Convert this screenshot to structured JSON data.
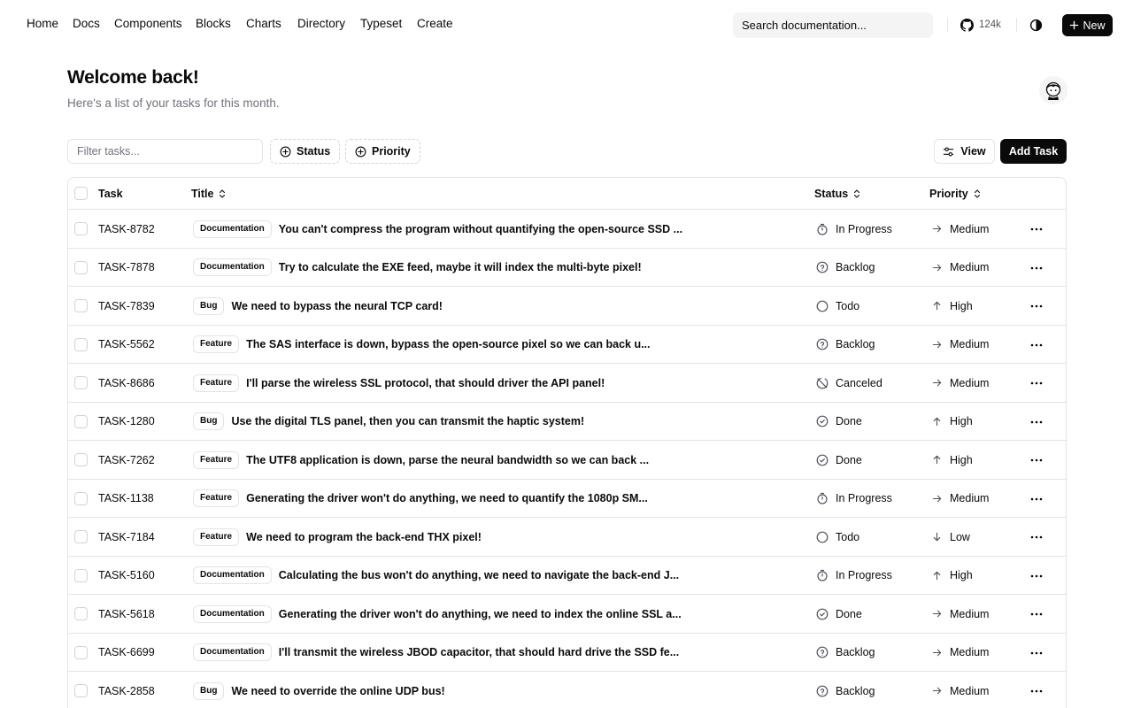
{
  "nav": {
    "links": [
      "Home",
      "Docs",
      "Components",
      "Blocks",
      "Charts",
      "Directory",
      "Typeset",
      "Create"
    ],
    "search_label": "Search documentation...",
    "github_stars": "124k",
    "new_label": "New"
  },
  "header": {
    "title": "Welcome back!",
    "subtitle": "Here's a list of your tasks for this month."
  },
  "toolbar": {
    "filter_placeholder": "Filter tasks...",
    "status_label": "Status",
    "priority_label": "Priority",
    "view_label": "View",
    "add_task_label": "Add Task"
  },
  "table": {
    "columns": {
      "task": "Task",
      "title": "Title",
      "status": "Status",
      "priority": "Priority"
    },
    "rows": [
      {
        "id": "TASK-8782",
        "label": "Documentation",
        "title": "You can't compress the program without quantifying the open-source SSD ...",
        "status": "In Progress",
        "status_icon": "timer-icon",
        "priority": "Medium",
        "priority_icon": "arrow-right-icon"
      },
      {
        "id": "TASK-7878",
        "label": "Documentation",
        "title": "Try to calculate the EXE feed, maybe it will index the multi-byte pixel!",
        "status": "Backlog",
        "status_icon": "help-circle-icon",
        "priority": "Medium",
        "priority_icon": "arrow-right-icon"
      },
      {
        "id": "TASK-7839",
        "label": "Bug",
        "title": "We need to bypass the neural TCP card!",
        "status": "Todo",
        "status_icon": "circle-icon",
        "priority": "High",
        "priority_icon": "arrow-up-icon"
      },
      {
        "id": "TASK-5562",
        "label": "Feature",
        "title": "The SAS interface is down, bypass the open-source pixel so we can back u...",
        "status": "Backlog",
        "status_icon": "help-circle-icon",
        "priority": "Medium",
        "priority_icon": "arrow-right-icon"
      },
      {
        "id": "TASK-8686",
        "label": "Feature",
        "title": "I'll parse the wireless SSL protocol, that should driver the API panel!",
        "status": "Canceled",
        "status_icon": "circle-off-icon",
        "priority": "Medium",
        "priority_icon": "arrow-right-icon"
      },
      {
        "id": "TASK-1280",
        "label": "Bug",
        "title": "Use the digital TLS panel, then you can transmit the haptic system!",
        "status": "Done",
        "status_icon": "check-circle-icon",
        "priority": "High",
        "priority_icon": "arrow-up-icon"
      },
      {
        "id": "TASK-7262",
        "label": "Feature",
        "title": "The UTF8 application is down, parse the neural bandwidth so we can back ...",
        "status": "Done",
        "status_icon": "check-circle-icon",
        "priority": "High",
        "priority_icon": "arrow-up-icon"
      },
      {
        "id": "TASK-1138",
        "label": "Feature",
        "title": "Generating the driver won't do anything, we need to quantify the 1080p SM...",
        "status": "In Progress",
        "status_icon": "timer-icon",
        "priority": "Medium",
        "priority_icon": "arrow-right-icon"
      },
      {
        "id": "TASK-7184",
        "label": "Feature",
        "title": "We need to program the back-end THX pixel!",
        "status": "Todo",
        "status_icon": "circle-icon",
        "priority": "Low",
        "priority_icon": "arrow-down-icon"
      },
      {
        "id": "TASK-5160",
        "label": "Documentation",
        "title": "Calculating the bus won't do anything, we need to navigate the back-end J...",
        "status": "In Progress",
        "status_icon": "timer-icon",
        "priority": "High",
        "priority_icon": "arrow-up-icon"
      },
      {
        "id": "TASK-5618",
        "label": "Documentation",
        "title": "Generating the driver won't do anything, we need to index the online SSL a...",
        "status": "Done",
        "status_icon": "check-circle-icon",
        "priority": "Medium",
        "priority_icon": "arrow-right-icon"
      },
      {
        "id": "TASK-6699",
        "label": "Documentation",
        "title": "I'll transmit the wireless JBOD capacitor, that should hard drive the SSD fe...",
        "status": "Backlog",
        "status_icon": "help-circle-icon",
        "priority": "Medium",
        "priority_icon": "arrow-right-icon"
      },
      {
        "id": "TASK-2858",
        "label": "Bug",
        "title": "We need to override the online UDP bus!",
        "status": "Backlog",
        "status_icon": "help-circle-icon",
        "priority": "Medium",
        "priority_icon": "arrow-right-icon"
      }
    ]
  }
}
